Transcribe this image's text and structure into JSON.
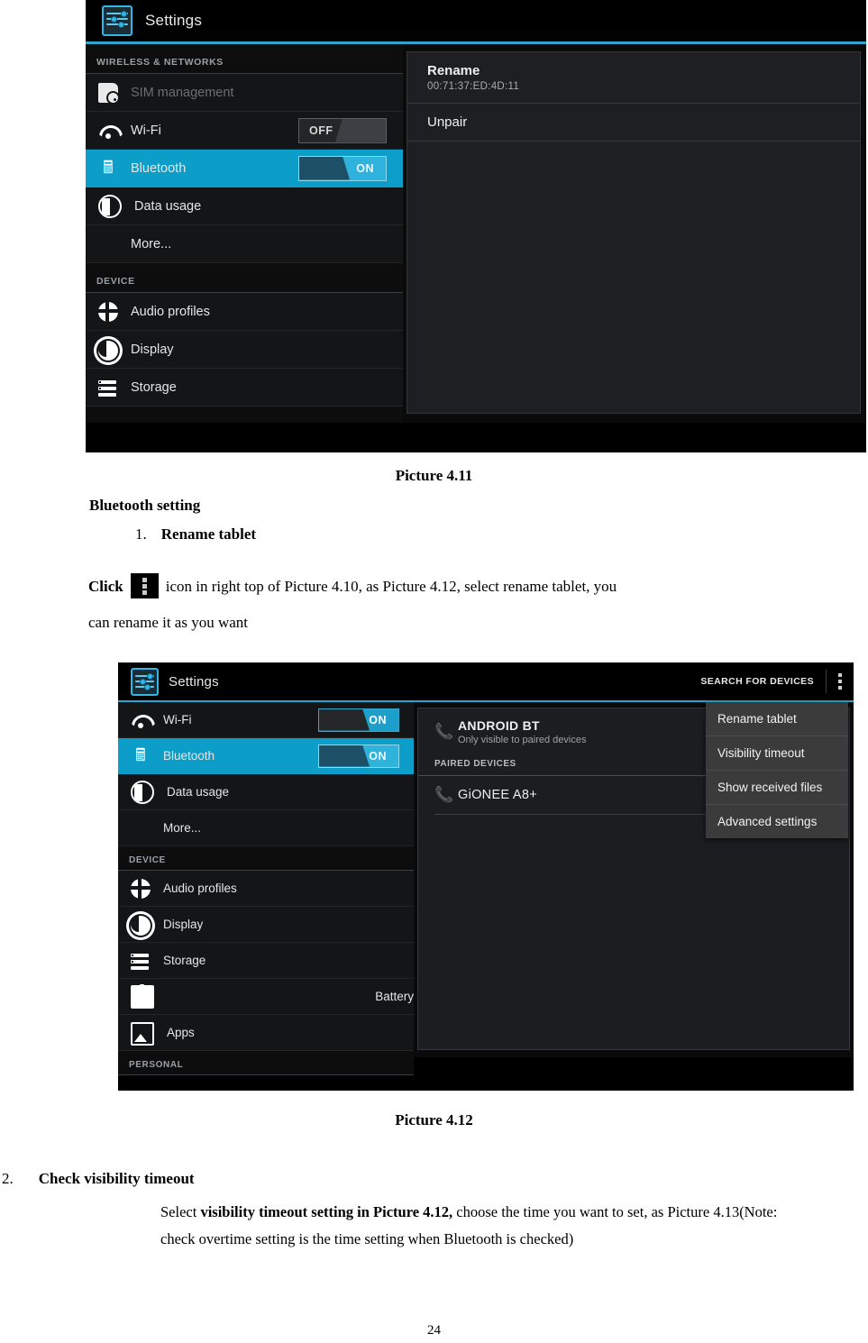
{
  "screenshot_411": {
    "actionbar": {
      "title": "Settings",
      "app_icon": "settings-sliders-icon"
    },
    "sidebar": {
      "sections": [
        {
          "header": "WIRELESS & NETWORKS",
          "items": [
            {
              "label": "SIM management",
              "icon": "sim-card-icon",
              "state": "disabled",
              "toggle": null
            },
            {
              "label": "Wi-Fi",
              "icon": "wifi-icon",
              "state": "normal",
              "toggle": "OFF"
            },
            {
              "label": "Bluetooth",
              "icon": "bluetooth-icon",
              "state": "selected",
              "toggle": "ON"
            },
            {
              "label": "Data usage",
              "icon": "data-usage-icon",
              "state": "normal",
              "toggle": null
            },
            {
              "label": "More...",
              "icon": null,
              "state": "normal",
              "toggle": null
            }
          ]
        },
        {
          "header": "DEVICE",
          "items": [
            {
              "label": "Audio profiles",
              "icon": "audio-profiles-icon",
              "state": "normal",
              "toggle": null
            },
            {
              "label": "Display",
              "icon": "display-brightness-icon",
              "state": "normal",
              "toggle": null
            },
            {
              "label": "Storage",
              "icon": "storage-icon",
              "state": "normal",
              "toggle": null
            }
          ]
        }
      ]
    },
    "detail_pane": {
      "rename": {
        "title": "Rename",
        "mac_address": "00:71:37:ED:4D:11"
      },
      "unpair": {
        "title": "Unpair"
      }
    }
  },
  "screenshot_412": {
    "actionbar": {
      "title": "Settings",
      "app_icon": "settings-sliders-icon",
      "search_label": "SEARCH FOR DEVICES",
      "overflow_icon": "overflow-menu-icon"
    },
    "sidebar": {
      "sections": [
        {
          "header": "",
          "items": [
            {
              "label": "Wi-Fi",
              "icon": "wifi-icon",
              "state": "normal",
              "toggle": "ON"
            },
            {
              "label": "Bluetooth",
              "icon": "bluetooth-icon",
              "state": "selected",
              "toggle": "ON"
            },
            {
              "label": "Data usage",
              "icon": "data-usage-icon",
              "state": "normal",
              "toggle": null
            },
            {
              "label": "More...",
              "icon": null,
              "state": "normal",
              "toggle": null
            }
          ]
        },
        {
          "header": "DEVICE",
          "items": [
            {
              "label": "Audio profiles",
              "icon": "audio-profiles-icon",
              "state": "normal",
              "toggle": null
            },
            {
              "label": "Display",
              "icon": "display-brightness-icon",
              "state": "normal",
              "toggle": null
            },
            {
              "label": "Storage",
              "icon": "storage-icon",
              "state": "normal",
              "toggle": null
            },
            {
              "label": "Battery",
              "icon": "battery-icon",
              "state": "normal",
              "toggle": null
            },
            {
              "label": "Apps",
              "icon": "apps-image-icon",
              "state": "normal",
              "toggle": null
            }
          ]
        },
        {
          "header": "PERSONAL",
          "items": []
        }
      ]
    },
    "bluetooth_pane": {
      "local_device": {
        "name": "ANDROID BT",
        "subtitle": "Only visible to paired devices",
        "icon": "phone-icon"
      },
      "paired_header": "PAIRED DEVICES",
      "paired_devices": [
        {
          "name": "GiONEE A8+",
          "icon": "phone-icon"
        }
      ]
    },
    "overflow_menu": {
      "items": [
        "Rename tablet",
        "Visibility timeout",
        "Show received files",
        "Advanced settings"
      ]
    }
  },
  "document": {
    "caption_411": "Picture 4.11",
    "caption_412": "Picture 4.12",
    "heading_bluetooth": "Bluetooth setting",
    "item1_number": "1.",
    "item1_title": "Rename tablet",
    "click_prefix": "Click",
    "click_icon": "overflow-menu-icon",
    "click_rest": "icon in right top of Picture 4.10, as Picture 4.12, select rename tablet, you",
    "click_line2": "can rename it as you want",
    "item2_number": "2.",
    "item2_title": "Check visibility timeout",
    "para2_lead": "Select ",
    "para2_bold": "visibility timeout setting in Picture 4.12,",
    "para2_rest": " choose the time you want to set, as Picture 4.13(Note: check overtime setting is the time setting when Bluetooth is checked)",
    "page_number": "24"
  },
  "colors": {
    "accent_cyan": "#0d9dc9",
    "actionbar_rule": "#2ca5d4",
    "panel_dark": "#1d1f22",
    "menu_gray": "#3b3b3b",
    "row_dark": "#131517"
  }
}
